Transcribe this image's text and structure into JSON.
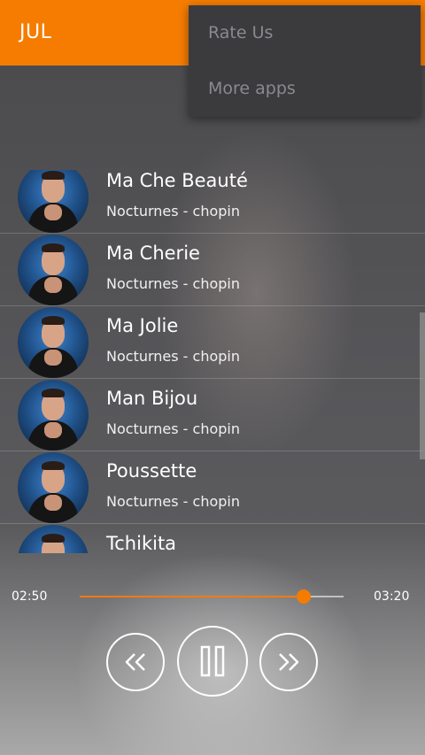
{
  "app": {
    "title": "JUL"
  },
  "overflow_menu": {
    "items": [
      "Rate Us",
      "More apps"
    ]
  },
  "songs": [
    {
      "title": "Ma Che Beauté",
      "artist": "Nocturnes - chopin"
    },
    {
      "title": "Ma Cherie",
      "artist": "Nocturnes - chopin"
    },
    {
      "title": "Ma Jolie",
      "artist": "Nocturnes - chopin"
    },
    {
      "title": "Man Bijou",
      "artist": "Nocturnes - chopin"
    },
    {
      "title": "Poussette",
      "artist": "Nocturnes - chopin"
    },
    {
      "title": "Tchikita",
      "artist": ""
    }
  ],
  "player": {
    "elapsed": "02:50",
    "duration": "03:20",
    "progress": 0.85,
    "accent_color": "#f57c00",
    "controls": [
      "rewind-icon",
      "pause-icon",
      "fast-forward-icon"
    ]
  },
  "colors": {
    "toolbar": "#f57c00",
    "menu_bg": "#3b3b3e"
  }
}
